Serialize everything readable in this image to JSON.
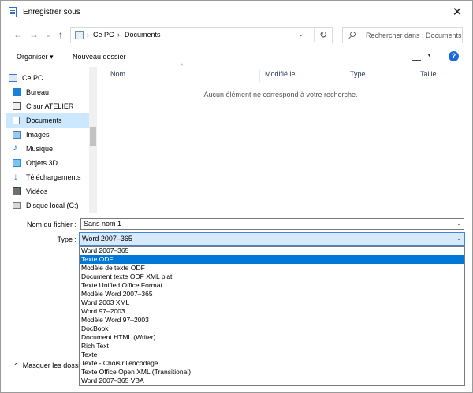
{
  "window": {
    "title": "Enregistrer sous",
    "close_glyph": "✕"
  },
  "nav": {
    "back_glyph": "←",
    "forward_glyph": "→",
    "recent_glyph": "⌄",
    "up_glyph": "↑",
    "address_segments": [
      "Ce PC",
      "Documents"
    ],
    "address_sep": "›",
    "address_drop_glyph": "⌄",
    "refresh_glyph": "↻",
    "search_placeholder": "Rechercher dans : Documents"
  },
  "toolbar": {
    "organize_label": "Organiser ▾",
    "new_folder_label": "Nouveau dossier",
    "view_drop_glyph": "▼",
    "help_glyph": "?"
  },
  "sidebar": {
    "items": [
      {
        "label": "Ce PC",
        "icon": "computer-icon",
        "selected": false
      },
      {
        "label": "Bureau",
        "icon": "desktop-icon",
        "selected": false
      },
      {
        "label": "C sur ATELIER",
        "icon": "network-drive-icon",
        "selected": false
      },
      {
        "label": "Documents",
        "icon": "documents-icon",
        "selected": true
      },
      {
        "label": "Images",
        "icon": "images-icon",
        "selected": false
      },
      {
        "label": "Musique",
        "icon": "music-icon",
        "selected": false
      },
      {
        "label": "Objets 3D",
        "icon": "objects-3d-icon",
        "selected": false
      },
      {
        "label": "Téléchargements",
        "icon": "downloads-icon",
        "selected": false
      },
      {
        "label": "Vidéos",
        "icon": "videos-icon",
        "selected": false
      },
      {
        "label": "Disque local (C:)",
        "icon": "local-disk-icon",
        "selected": false
      }
    ]
  },
  "filelist": {
    "sort_glyph": "^",
    "columns": [
      "Nom",
      "Modifié le",
      "Type",
      "Taille"
    ],
    "empty_message": "Aucun élément ne correspond à votre recherche."
  },
  "form": {
    "filename_label": "Nom du fichier :",
    "filename_value": "Sans nom 1",
    "type_label": "Type :",
    "type_value": "Word 2007–365",
    "drop_glyph": "⌄"
  },
  "dropdown": {
    "options": [
      {
        "label": "Word 2007–365",
        "selected": false
      },
      {
        "label": "Texte ODF",
        "selected": true
      },
      {
        "label": "Modèle de texte ODF",
        "selected": false
      },
      {
        "label": "Document texte ODF XML plat",
        "selected": false
      },
      {
        "label": "Texte Unified Office Format",
        "selected": false
      },
      {
        "label": "Modèle Word 2007–365",
        "selected": false
      },
      {
        "label": "Word 2003 XML",
        "selected": false
      },
      {
        "label": "Word 97–2003",
        "selected": false
      },
      {
        "label": "Modèle Word 97–2003",
        "selected": false
      },
      {
        "label": "DocBook",
        "selected": false
      },
      {
        "label": "Document HTML (Writer)",
        "selected": false
      },
      {
        "label": "Rich Text",
        "selected": false
      },
      {
        "label": "Texte",
        "selected": false
      },
      {
        "label": "Texte - Choisir l'encodage",
        "selected": false
      },
      {
        "label": "Texte Office Open XML (Transitional)",
        "selected": false
      },
      {
        "label": "Word 2007–365 VBA",
        "selected": false
      }
    ]
  },
  "footer": {
    "toggle_glyph": "⌃",
    "hide_folders_label": "Masquer les dossi"
  }
}
